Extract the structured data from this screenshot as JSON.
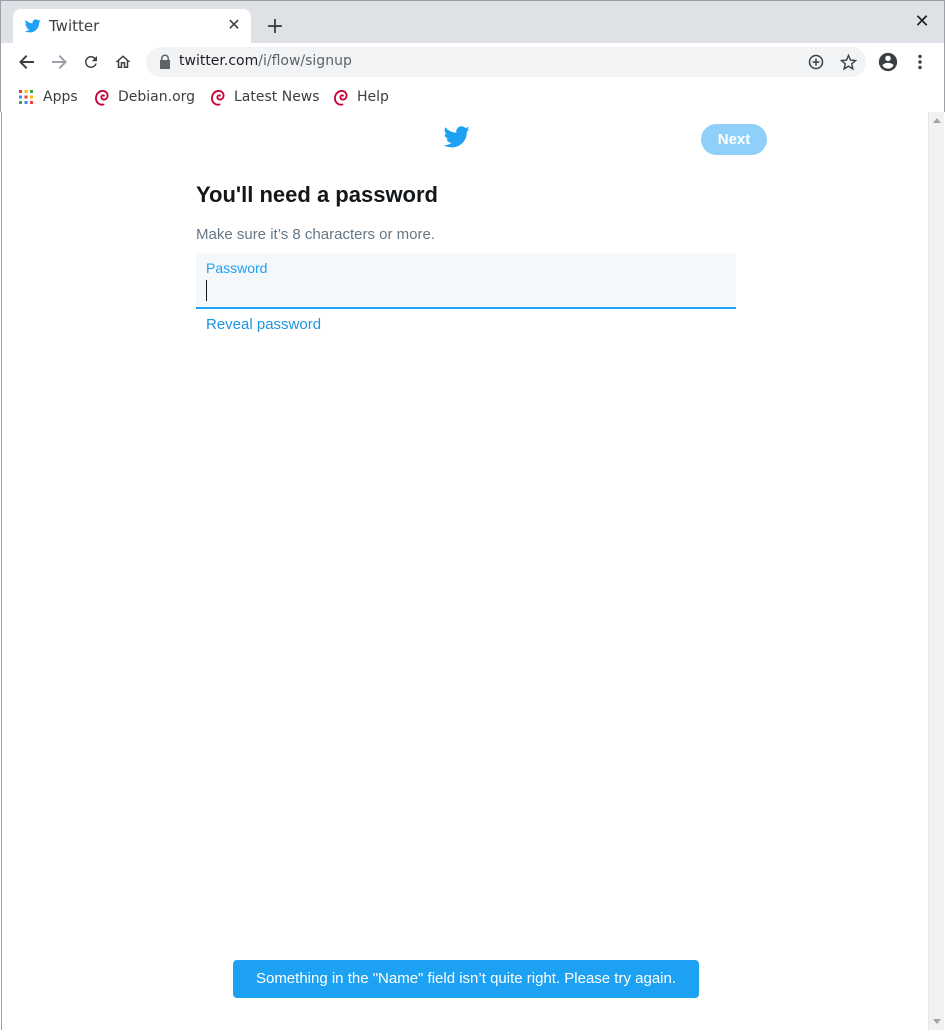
{
  "browser": {
    "tab": {
      "title": "Twitter",
      "close_glyph": "✕"
    },
    "new_tab_glyph": "+",
    "window_close_glyph": "✕",
    "url": {
      "host": "twitter.com",
      "path": "/i/flow/signup"
    },
    "bookmarks": [
      {
        "label": "Apps",
        "icon": "apps-grid-icon"
      },
      {
        "label": "Debian.org",
        "icon": "debian-swirl-icon"
      },
      {
        "label": "Latest News",
        "icon": "debian-swirl-icon"
      },
      {
        "label": "Help",
        "icon": "debian-swirl-icon"
      }
    ]
  },
  "page": {
    "next_label": "Next",
    "heading": "You'll need a password",
    "subtext": "Make sure it’s 8 characters or more.",
    "password_label": "Password",
    "password_value": "",
    "reveal_label": "Reveal password",
    "toast": "Something in the \"Name\" field isn’t quite right. Please try again."
  },
  "colors": {
    "twitter_blue": "#1da1f2",
    "next_disabled": "#8ed0f9",
    "link_blue": "#1b95e0",
    "heading_text": "#14171a",
    "subtext": "#657786",
    "field_bg": "#f5f8fa",
    "chrome_frame": "#dee1e6"
  }
}
